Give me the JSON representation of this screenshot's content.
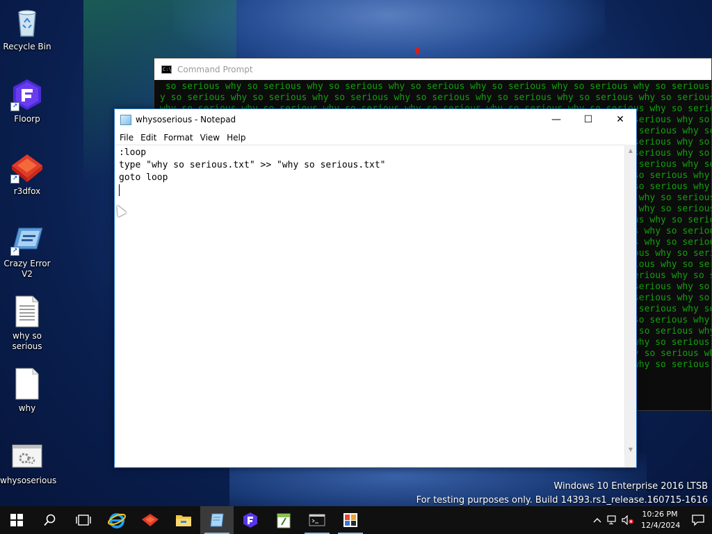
{
  "desktop": {
    "icons": [
      {
        "label": "Recycle Bin",
        "icon": "recycle-bin-icon"
      },
      {
        "label": "Floorp",
        "icon": "floorp-icon"
      },
      {
        "label": "r3dfox",
        "icon": "r3dfox-icon"
      },
      {
        "label": "Crazy Error V2",
        "icon": "crazy-error-icon"
      },
      {
        "label": "why so serious",
        "icon": "text-file-icon"
      },
      {
        "label": "why",
        "icon": "blank-file-icon"
      },
      {
        "label": "whysoserious",
        "icon": "batch-file-icon"
      }
    ]
  },
  "cmd": {
    "title": "Command Prompt",
    "text_color": "#13a10e",
    "lines": [
      " so serious why so serious why so serious why so serious why so serious why so serious why so serious why so serious",
      "y so serious why so serious why so serious why so serious why so serious why so serious why so serious why so serious",
      "why so serious why so serious why so serious why so serious why so serious why so serious why so serious why so serio",
      "ious why so serious why so serious why so serious why so serious why so serious why so serious why so serious why so ",
      "rious why so serious why so serious why so serious why so serious why so serious why so serious why so serious why so",
      "ious why so serious why so serious why so serious why so serious why so serious why so serious why so serious why so ",
      "ious why so serious why so serious why so serious why so serious why so serious why so serious why so serious why so ",
      "rious why so serious why so serious why so serious why so serious why so serious why so serious why so serious why so",
      "serious why so serious why so serious why so serious why so serious why so serious why so serious why so serious why",
      "serious why so serious why so serious why so serious why so serious why so serious why so serious why so serious why",
      "y so serious why so serious why so serious why so serious why so serious why so serious why so serious why so serious",
      "y so serious why so serious why so serious why so serious why so serious why so serious why so serious why so serious",
      "why so serious why so serious why so serious why so serious why so serious why so serious why so serious why so serio",
      "hy so serious why so serious why so serious why so serious why so serious why so serious why so serious why so seriou",
      "hy so serious why so serious why so serious why so serious why so serious why so serious why so serious why so seriou",
      " why so serious why so serious why so serious why so serious why so serious why so serious why so serious why so seri",
      "s why so serious why so serious why so serious why so serious why so serious why so serious why so serious why so ser",
      "ous why so serious why so serious why so serious why so serious why so serious why so serious why so serious why so s",
      "ious why so serious why so serious why so serious why so serious why so serious why so serious why so serious why so ",
      "ious why so serious why so serious why so serious why so serious why so serious why so serious why so serious why so ",
      "rious why so serious why so serious why so serious why so serious why so serious why so serious why so serious why so",
      "serious why so serious why so serious why so serious why so serious why so serious why so serious why so serious why",
      " serious why so serious why so serious why so serious why so serious why so serious why so serious why so serious why",
      " so serious why so serious why so serious why so serious why so serious why so serious why so serious why so serious",
      "o serious why so serious why so serious why so serious why so serious why so serious why so serious why so serious wh",
      " so serious why so serious why so serious why so serious why so serious why so serious why so serious why so serious "
    ]
  },
  "notepad": {
    "title": "whysoserious - Notepad",
    "menu": [
      "File",
      "Edit",
      "Format",
      "View",
      "Help"
    ],
    "content": ":loop\ntype \"why so serious.txt\" >> \"why so serious.txt\"\ngoto loop\n",
    "minimize": "—",
    "maximize": "☐",
    "close": "✕"
  },
  "watermark": {
    "line1": "Windows 10 Enterprise 2016 LTSB",
    "line2": "For testing purposes only. Build 14393.rs1_release.160715-1616"
  },
  "taskbar": {
    "apps": [
      "start-icon",
      "search-icon",
      "task-view-icon",
      "internet-explorer-icon",
      "r3dfox-icon",
      "file-explorer-icon",
      "notepad-icon",
      "floorp-icon",
      "notepad-plus-icon",
      "command-prompt-icon",
      "crazy-error-icon"
    ],
    "time": "10:26 PM",
    "date": "12/4/2024"
  }
}
